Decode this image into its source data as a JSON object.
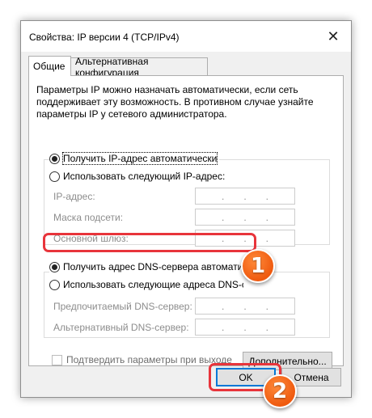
{
  "window": {
    "title": "Свойства: IP версии 4 (TCP/IPv4)",
    "close_glyph": "✕"
  },
  "tabs": [
    {
      "label": "Общие",
      "active": true
    },
    {
      "label": "Альтернативная конфигурация",
      "active": false
    }
  ],
  "general": {
    "description": "Параметры IP можно назначать автоматически, если сеть поддерживает эту возможность. В противном случае узнайте параметры IP у сетевого администратора.",
    "ip_auto_label": "Получить IP-адрес автоматически",
    "ip_manual_label": "Использовать следующий IP-адрес:",
    "ip_address_label": "IP-адрес:",
    "subnet_mask_label": "Маска подсети:",
    "gateway_label": "Основной шлюз:",
    "dns_auto_label": "Получить адрес DNS-сервера автоматически",
    "dns_manual_label": "Использовать следующие адреса DNS-сервера:",
    "preferred_dns_label": "Предпочитаемый DNS-сервер:",
    "alternate_dns_label": "Альтернативный DNS-сервер:",
    "ip_placeholder_dot": ".",
    "validate_label": "Подтвердить параметры при выходе",
    "advanced_button": "Дополнительно..."
  },
  "footer": {
    "ok_button": "OK",
    "cancel_button": "Отмена"
  },
  "annotations": {
    "step1": "1",
    "step2": "2",
    "highlight_color": "#e8343b",
    "badge_color": "#ef5a0f"
  }
}
